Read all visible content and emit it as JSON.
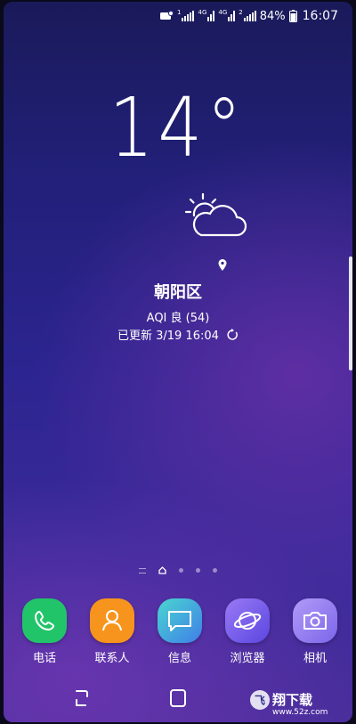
{
  "status_bar": {
    "signal_1_label": "1",
    "network_1": "4G",
    "network_2": "4G",
    "signal_2_label": "2",
    "battery": "84%",
    "time": "16:07"
  },
  "weather": {
    "temperature": "14°",
    "condition_icon": "partly-cloudy-icon",
    "location": "朝阳区",
    "aqi": "AQI 良 (54)",
    "updated": "已更新 3/19 16:04"
  },
  "pages": {
    "count": 5,
    "current": 1
  },
  "dock": {
    "apps": [
      {
        "label": "电话",
        "icon": "phone-icon",
        "color": "#22c46a"
      },
      {
        "label": "联系人",
        "icon": "contacts-icon",
        "color": "#f7941d"
      },
      {
        "label": "信息",
        "icon": "messages-icon",
        "color": "#38c3e0"
      },
      {
        "label": "浏览器",
        "icon": "browser-icon",
        "color": "#7a5cf0"
      },
      {
        "label": "相机",
        "icon": "camera-icon",
        "color": "#8a74f0"
      }
    ]
  },
  "navigation": {
    "recent": "recent-apps-icon",
    "home": "home-button-icon"
  },
  "watermark": {
    "brand": "飞翔下载",
    "url": "www.52z.com"
  }
}
